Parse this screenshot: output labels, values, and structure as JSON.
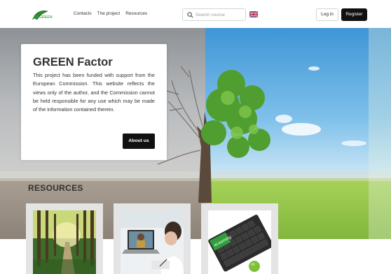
{
  "header": {
    "logo_text": "GREEN",
    "nav": [
      "Contacts",
      "The project",
      "Resources"
    ],
    "search_placeholder": "Search course",
    "login_label": "Log in",
    "register_label": "Register"
  },
  "hero": {
    "title": "GREEN Factor",
    "body": "This project has been funded with support from the European Commission. This website reflects the views only of the author, and the Commission cannot be held responsible for any use which may be made of the information contained therein.",
    "about_label": "About us"
  },
  "resources": {
    "heading": "RESOURCES",
    "cards": [
      {
        "icon": "forest-path-image"
      },
      {
        "icon": "online-learning-image",
        "laptop_text": ""
      },
      {
        "icon": "elearning-keyboard-image",
        "key_text": "eLearning"
      }
    ]
  },
  "colors": {
    "accent": "#111111",
    "leaf_green": "#2f8a2f",
    "sky": "#5aa8e0",
    "grass": "#7fbf3a"
  }
}
